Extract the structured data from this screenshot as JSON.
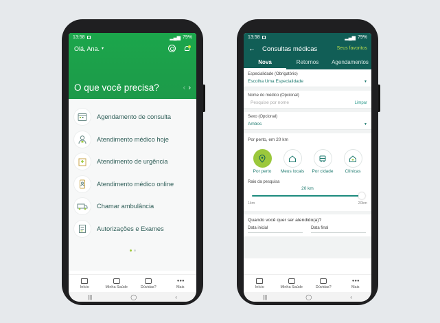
{
  "left_phone": {
    "status": {
      "time": "13:58",
      "battery": "79%"
    },
    "greeting": "Olá, Ana.",
    "heading": "O que você precisa?",
    "menu": [
      {
        "label": "Agendamento de consulta",
        "icon": "calendar-icon"
      },
      {
        "label": "Atendimento médico hoje",
        "icon": "doctor-icon"
      },
      {
        "label": "Atendimento de urgência",
        "icon": "hospital-icon"
      },
      {
        "label": "Atendimento médico online",
        "icon": "phone-doctor-icon"
      },
      {
        "label": "Chamar ambulância",
        "icon": "ambulance-icon"
      },
      {
        "label": "Autorizações e Exames",
        "icon": "document-icon"
      }
    ],
    "tabs": [
      "Início",
      "Minha Saúde",
      "Dúvidas?",
      "Mais"
    ]
  },
  "right_phone": {
    "status": {
      "time": "13:58",
      "battery": "79%"
    },
    "title": "Consultas médicas",
    "favorites": "Seus favoritos",
    "tabs": [
      "Nova",
      "Retornos",
      "Agendamentos"
    ],
    "specialty": {
      "label": "Especialidade (Obrigatório)",
      "value": "Escolha Uma Especialidade"
    },
    "doctor": {
      "label": "Nome do médico (Opcional)",
      "placeholder": "Pesquise por nome",
      "clear": "Limpar"
    },
    "sex": {
      "label": "Sexo (Opcional)",
      "value": "Ambos"
    },
    "nearby": {
      "title": "Por perto, em 20 km",
      "options": [
        "Por perto",
        "Meus locais",
        "Por cidade",
        "Clínicas"
      ],
      "radius_label": "Raio da pesquisa",
      "radius_value": "20 km",
      "radius_fraction": 1.0,
      "min": "1km",
      "max": "20km"
    },
    "when": {
      "title": "Quando você quer ser atendido(a)?",
      "start": "Data inicial",
      "end": "Data final"
    },
    "bottom_tabs": [
      "Início",
      "Minha Saúde",
      "Dúvidas?",
      "Mais"
    ]
  },
  "colors": {
    "green": "#1ba64b",
    "teal": "#115e56",
    "lime": "#9bc83c",
    "text_teal": "#2f5e58"
  }
}
